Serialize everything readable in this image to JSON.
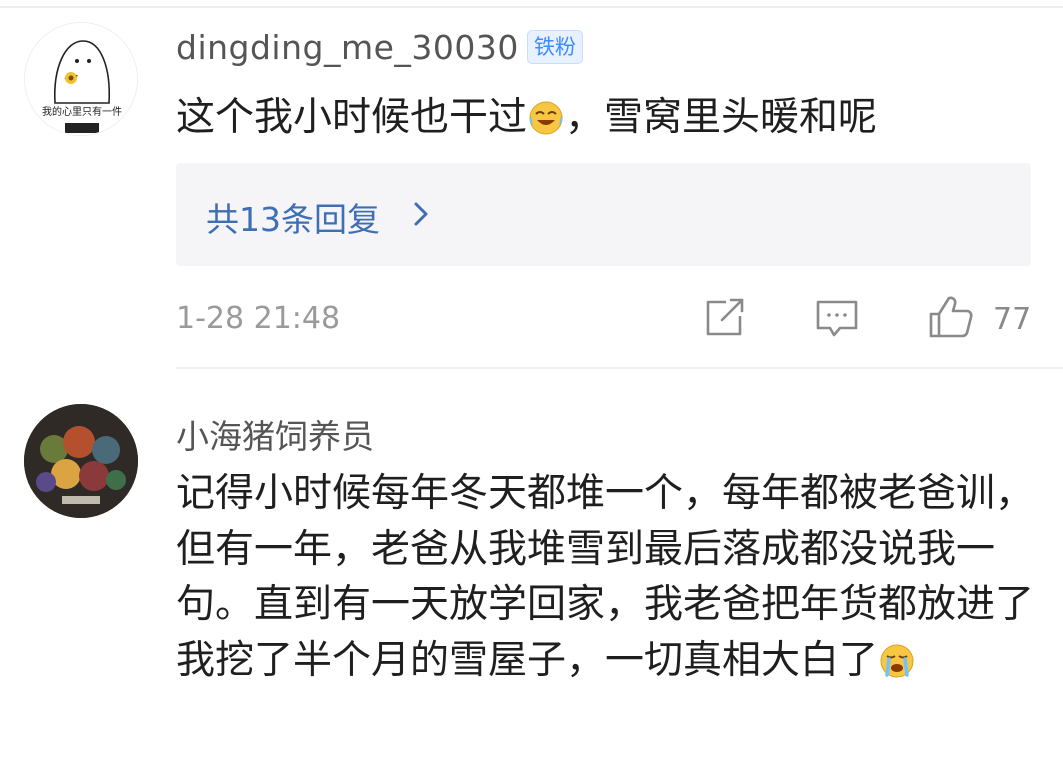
{
  "comments": [
    {
      "username": "dingding_me_30030",
      "badge": "铁粉",
      "avatar_caption": "我的心里只有一件",
      "text_before_emoji": "这个我小时候也干过",
      "emoji": "laughing-crying-emoji",
      "text_after_emoji": "，雪窝里头暖和呢",
      "replies_label": "共13条回复",
      "timestamp": "1-28 21:48",
      "like_count": "77"
    },
    {
      "username": "小海猪饲养员",
      "text": "记得小时候每年冬天都堆一个，每年都被老爸训，但有一年，老爸从我堆雪到最后落成都没说我一句。直到有一天放学回家，我老爸把年货都放进了我挖了半个月的雪屋子，一切真相大白了",
      "emoji": "crying-emoji"
    }
  ],
  "colors": {
    "link_blue": "#3e6fb5",
    "badge_blue": "#3f8cff",
    "text": "#1f1f1f",
    "meta_gray": "#9a9a9a"
  }
}
